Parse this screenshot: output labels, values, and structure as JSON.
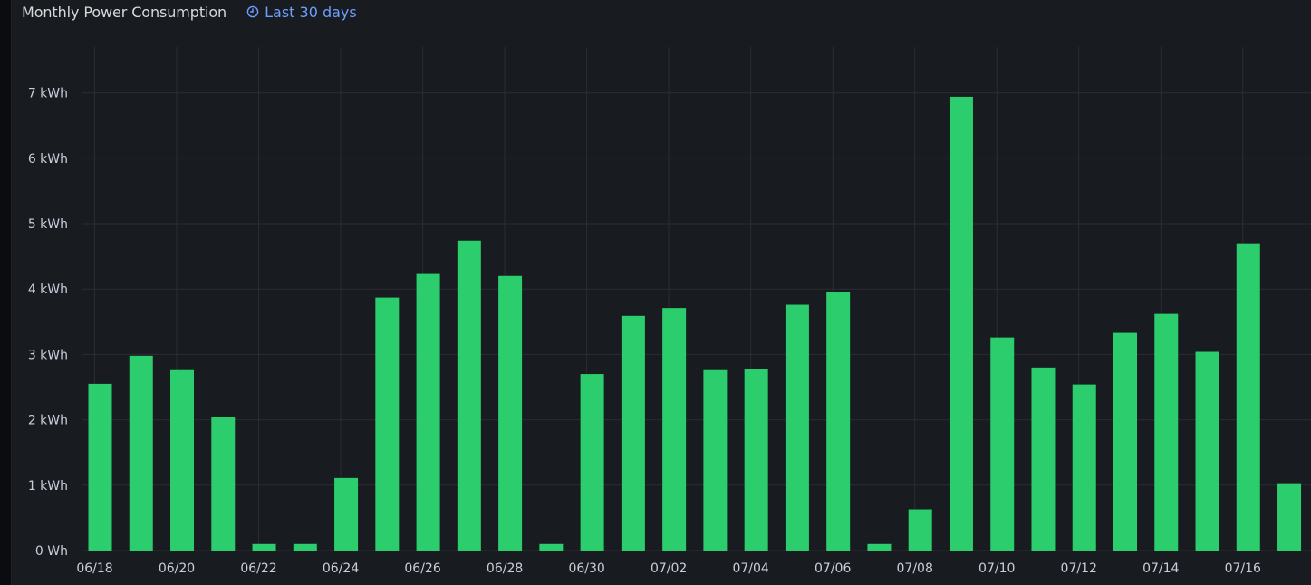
{
  "panel": {
    "title": "Monthly Power Consumption",
    "time_range": "Last 30 days",
    "time_icon": "clock-icon"
  },
  "colors": {
    "bar": "#2ccd6c",
    "grid": "#2b2d33",
    "axis_text": "#ccccdc",
    "title": "#d8d9da",
    "link": "#6e9fff",
    "panel_bg": "#181b1f"
  },
  "chart_data": {
    "type": "bar",
    "title": "Monthly Power Consumption",
    "xlabel": "",
    "ylabel": "",
    "unit": "kWh",
    "ylim": [
      0,
      7.7
    ],
    "grid": true,
    "legend": "none",
    "y_ticks": [
      {
        "value": 0,
        "label": "0 Wh"
      },
      {
        "value": 1,
        "label": "1 kWh"
      },
      {
        "value": 2,
        "label": "2 kWh"
      },
      {
        "value": 3,
        "label": "3 kWh"
      },
      {
        "value": 4,
        "label": "4 kWh"
      },
      {
        "value": 5,
        "label": "5 kWh"
      },
      {
        "value": 6,
        "label": "6 kWh"
      },
      {
        "value": 7,
        "label": "7 kWh"
      }
    ],
    "x_tick_labels": [
      "06/18",
      "06/20",
      "06/22",
      "06/24",
      "06/26",
      "06/28",
      "06/30",
      "07/02",
      "07/04",
      "07/06",
      "07/08",
      "07/10",
      "07/12",
      "07/14",
      "07/16"
    ],
    "categories": [
      "06/18",
      "06/19",
      "06/20",
      "06/21",
      "06/22",
      "06/23",
      "06/24",
      "06/25",
      "06/26",
      "06/27",
      "06/28",
      "06/29",
      "06/30",
      "07/01",
      "07/02",
      "07/03",
      "07/04",
      "07/05",
      "07/06",
      "07/07",
      "07/08",
      "07/09",
      "07/10",
      "07/11",
      "07/12",
      "07/13",
      "07/14",
      "07/15",
      "07/16",
      "07/17"
    ],
    "values": [
      2.55,
      2.98,
      2.76,
      2.04,
      0.1,
      0.1,
      1.11,
      3.87,
      4.23,
      4.74,
      4.2,
      0.1,
      2.7,
      3.59,
      3.71,
      2.76,
      2.78,
      3.76,
      3.95,
      0.1,
      0.63,
      6.94,
      3.26,
      2.8,
      2.54,
      3.33,
      3.62,
      3.04,
      4.7,
      1.03
    ]
  }
}
